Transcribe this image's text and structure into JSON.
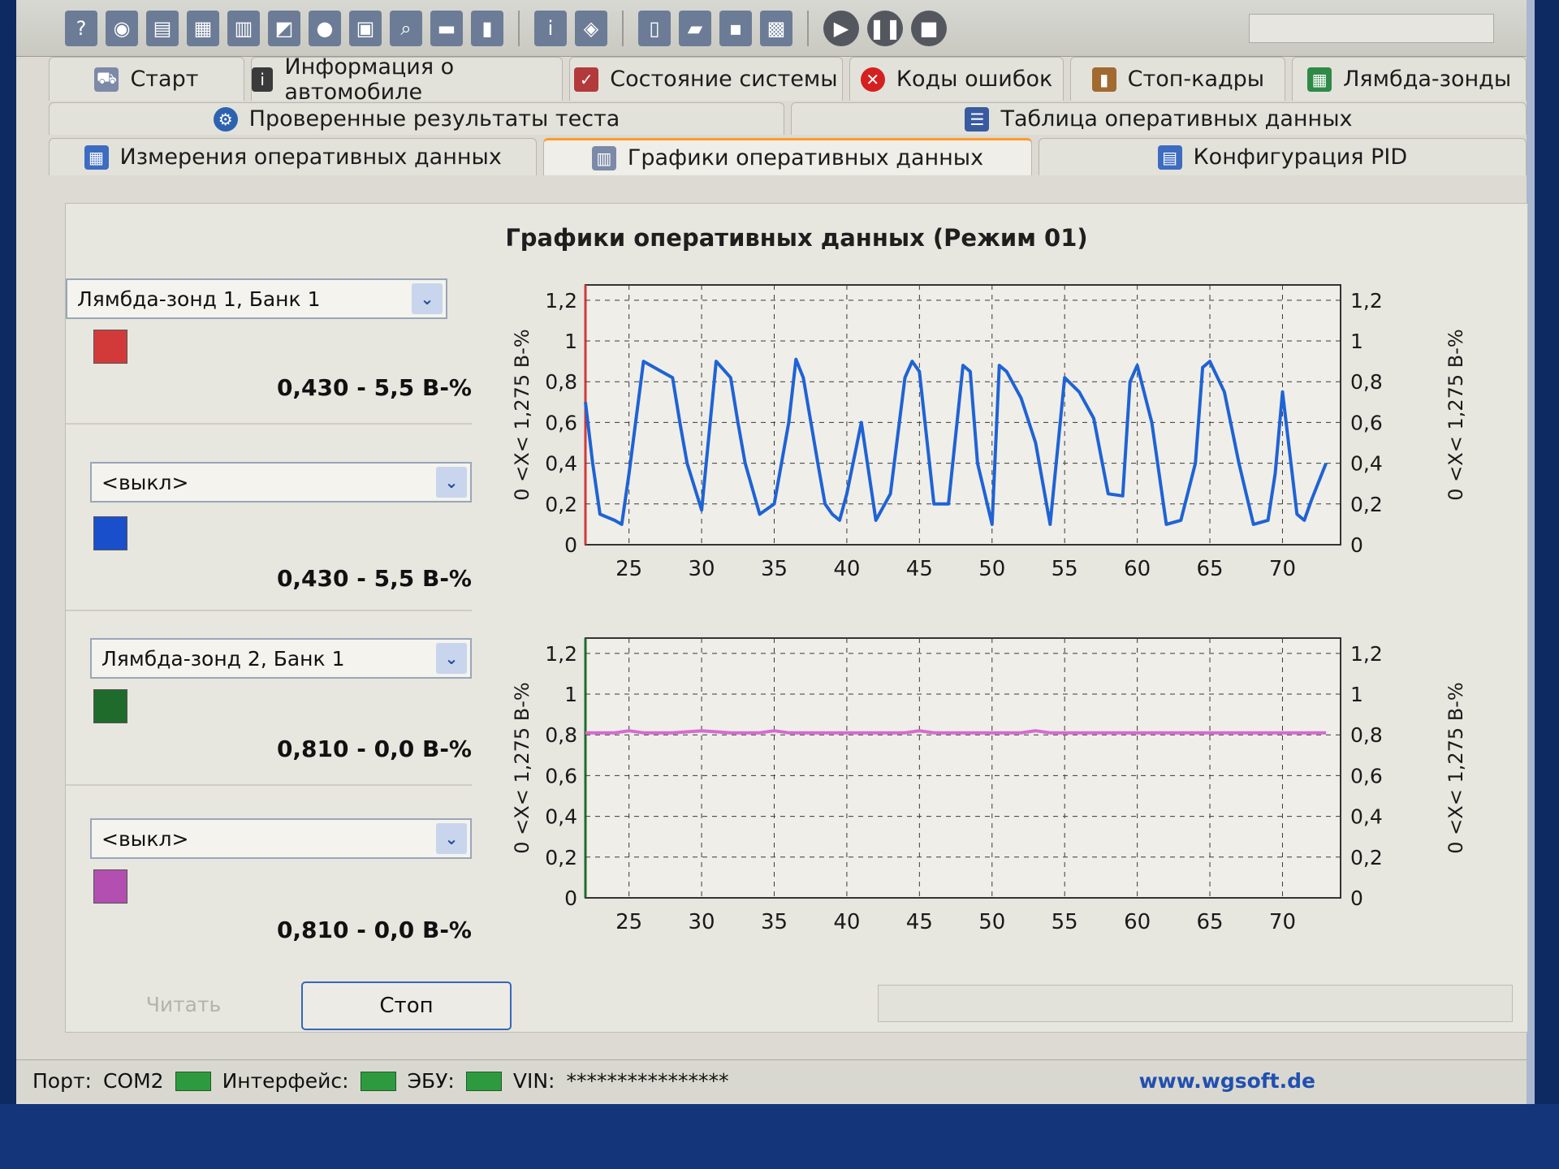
{
  "toolbar": {
    "icons": [
      "help-icon",
      "globe-icon",
      "document-icon",
      "table-icon",
      "measure-icon",
      "chart-icon",
      "record-icon",
      "clipboard-icon",
      "search-icon",
      "terminal-icon",
      "battery-icon",
      "info-icon",
      "shield-icon",
      "new-file-icon",
      "open-icon",
      "save-icon",
      "print-icon",
      "play-icon",
      "pause-icon",
      "stop-icon"
    ]
  },
  "tabs": {
    "row1": [
      "Старт",
      "Информация о автомобиле",
      "Состояние системы",
      "Коды ошибок",
      "Стоп-кадры",
      "Лямбда-зонды"
    ],
    "row2": [
      "Проверенные результаты теста",
      "Таблица оперативных данных"
    ],
    "row3": [
      "Измерения оперативных данных",
      "Графики оперативных данных",
      "Конфигурация PID"
    ]
  },
  "panel": {
    "title": "Графики оперативных данных (Режим 01)",
    "channels": [
      {
        "select": "Лямбда-зонд 1, Банк 1",
        "color": "#d23a3a",
        "value": "0,430 - 5,5 В-%"
      },
      {
        "select": "<выкл>",
        "color": "#1a4fcc",
        "value": "0,430 - 5,5 В-%"
      },
      {
        "select": "Лямбда-зонд 2, Банк 1",
        "color": "#1f6b2c",
        "value": "0,810 - 0,0 В-%"
      },
      {
        "select": "<выкл>",
        "color": "#b24fb0",
        "value": "0,810 - 0,0 В-%"
      }
    ],
    "axis_label": "0 <X< 1,275 В-%",
    "read_button": "Читать",
    "stop_button": "Стоп"
  },
  "status": {
    "port_label": "Порт:",
    "port_value": "COM2",
    "interface_label": "Интерфейс:",
    "ecu_label": "ЭБУ:",
    "vin_label": "VIN:",
    "vin_value": "****************",
    "url": "www.wgsoft.de"
  },
  "chart_data": [
    {
      "type": "line",
      "x_ticks": [
        25,
        30,
        35,
        40,
        45,
        50,
        55,
        60,
        65,
        70
      ],
      "y_ticks": [
        0,
        0.2,
        0.4,
        0.6,
        0.8,
        1,
        1.2
      ],
      "y_tick_labels": [
        "0",
        "0,2",
        "0,4",
        "0,6",
        "0,8",
        "1",
        "1,2"
      ],
      "xlim": [
        22,
        74
      ],
      "ylim": [
        0,
        1.275
      ],
      "grid": true,
      "series": [
        {
          "color": "#1f63d4",
          "x": [
            22,
            22.5,
            23,
            24,
            24.5,
            25,
            26,
            27,
            28,
            28.5,
            29,
            30,
            31,
            32,
            32.5,
            33,
            34,
            35,
            36,
            36.5,
            37,
            38,
            38.5,
            39,
            39.5,
            40,
            41,
            42,
            43,
            44,
            44.5,
            45,
            46,
            47,
            48,
            48.5,
            49,
            50,
            50.5,
            51,
            52,
            53,
            54,
            55,
            56,
            57,
            58,
            59,
            59.5,
            60,
            61,
            62,
            63,
            64,
            64.5,
            65,
            66,
            67,
            68,
            69,
            69.5,
            70,
            71,
            71.5,
            72,
            73
          ],
          "y": [
            0.7,
            0.4,
            0.15,
            0.12,
            0.1,
            0.35,
            0.9,
            0.86,
            0.82,
            0.6,
            0.4,
            0.17,
            0.9,
            0.82,
            0.6,
            0.4,
            0.15,
            0.2,
            0.6,
            0.91,
            0.82,
            0.4,
            0.2,
            0.15,
            0.12,
            0.25,
            0.6,
            0.12,
            0.25,
            0.82,
            0.9,
            0.85,
            0.2,
            0.2,
            0.88,
            0.85,
            0.4,
            0.1,
            0.88,
            0.85,
            0.72,
            0.5,
            0.1,
            0.82,
            0.75,
            0.62,
            0.25,
            0.24,
            0.8,
            0.88,
            0.6,
            0.1,
            0.12,
            0.4,
            0.87,
            0.9,
            0.75,
            0.4,
            0.1,
            0.12,
            0.35,
            0.75,
            0.15,
            0.12,
            0.22,
            0.4
          ]
        }
      ]
    },
    {
      "type": "line",
      "x_ticks": [
        25,
        30,
        35,
        40,
        45,
        50,
        55,
        60,
        65,
        70
      ],
      "y_ticks": [
        0,
        0.2,
        0.4,
        0.6,
        0.8,
        1,
        1.2
      ],
      "y_tick_labels": [
        "0",
        "0,2",
        "0,4",
        "0,6",
        "0,8",
        "1",
        "1,2"
      ],
      "xlim": [
        22,
        74
      ],
      "ylim": [
        0,
        1.275
      ],
      "grid": true,
      "series": [
        {
          "color": "#d66ad0",
          "x": [
            22,
            24,
            25,
            26,
            28,
            30,
            32,
            34,
            35,
            36,
            38,
            40,
            42,
            44,
            45,
            46,
            48,
            50,
            52,
            53,
            54,
            56,
            58,
            60,
            62,
            64,
            66,
            68,
            70,
            72,
            73
          ],
          "y": [
            0.81,
            0.81,
            0.82,
            0.81,
            0.81,
            0.82,
            0.81,
            0.81,
            0.82,
            0.81,
            0.81,
            0.81,
            0.81,
            0.81,
            0.82,
            0.81,
            0.81,
            0.81,
            0.81,
            0.82,
            0.81,
            0.81,
            0.81,
            0.81,
            0.81,
            0.81,
            0.81,
            0.81,
            0.81,
            0.81,
            0.81
          ]
        }
      ]
    }
  ]
}
